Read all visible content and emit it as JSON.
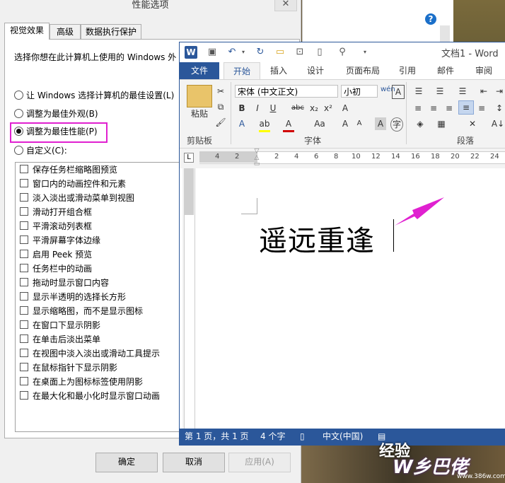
{
  "perf_dialog": {
    "title": "性能选项",
    "tabs": [
      "视觉效果",
      "高级",
      "数据执行保护"
    ],
    "description": "选择你想在此计算机上使用的 Windows 外",
    "radios": [
      {
        "label": "让 Windows 选择计算机的最佳设置(L)",
        "selected": false
      },
      {
        "label": "调整为最佳外观(B)",
        "selected": false
      },
      {
        "label": "调整为最佳性能(P)",
        "selected": true
      },
      {
        "label": "自定义(C):",
        "selected": false
      }
    ],
    "options": [
      "保存任务栏缩略图预览",
      "窗口内的动画控件和元素",
      "淡入淡出或滑动菜单到视图",
      "滑动打开组合框",
      "平滑滚动列表框",
      "平滑屏幕字体边缘",
      "启用 Peek 预览",
      "任务栏中的动画",
      "拖动时显示窗口内容",
      "显示半透明的选择长方形",
      "显示缩略图，而不是显示图标",
      "在窗口下显示阴影",
      "在单击后淡出菜单",
      "在视图中淡入淡出或滑动工具提示",
      "在鼠标指针下显示阴影",
      "在桌面上为图标标签使用阴影",
      "在最大化和最小化时显示窗口动画"
    ],
    "buttons": {
      "ok": "确定",
      "cancel": "取消",
      "apply": "应用(A)"
    },
    "highlight_color": "#e020d0"
  },
  "word": {
    "title": "文档1 - Word",
    "tabs": [
      "文件",
      "开始",
      "插入",
      "设计",
      "页面布局",
      "引用",
      "邮件",
      "审阅"
    ],
    "active_tab": "开始",
    "clipboard": {
      "paste": "粘贴",
      "label": "剪贴板"
    },
    "font": {
      "name": "宋体 (中文正文)",
      "size": "小初",
      "label": "字体"
    },
    "paragraph_label": "段落",
    "ruler_numbers": [
      "4",
      "2",
      "2",
      "4",
      "6",
      "8",
      "10",
      "12",
      "14",
      "16",
      "18",
      "20",
      "22",
      "24"
    ],
    "document_text": "遥远重逢",
    "status": {
      "page": "第 1 页，共 1 页",
      "words": "4 个字",
      "language": "中文(中国)"
    },
    "accent": "#2b579a"
  },
  "watermark": {
    "text": "经验",
    "brand": "W 乡 巴 佬",
    "url": "www.386w.com"
  }
}
